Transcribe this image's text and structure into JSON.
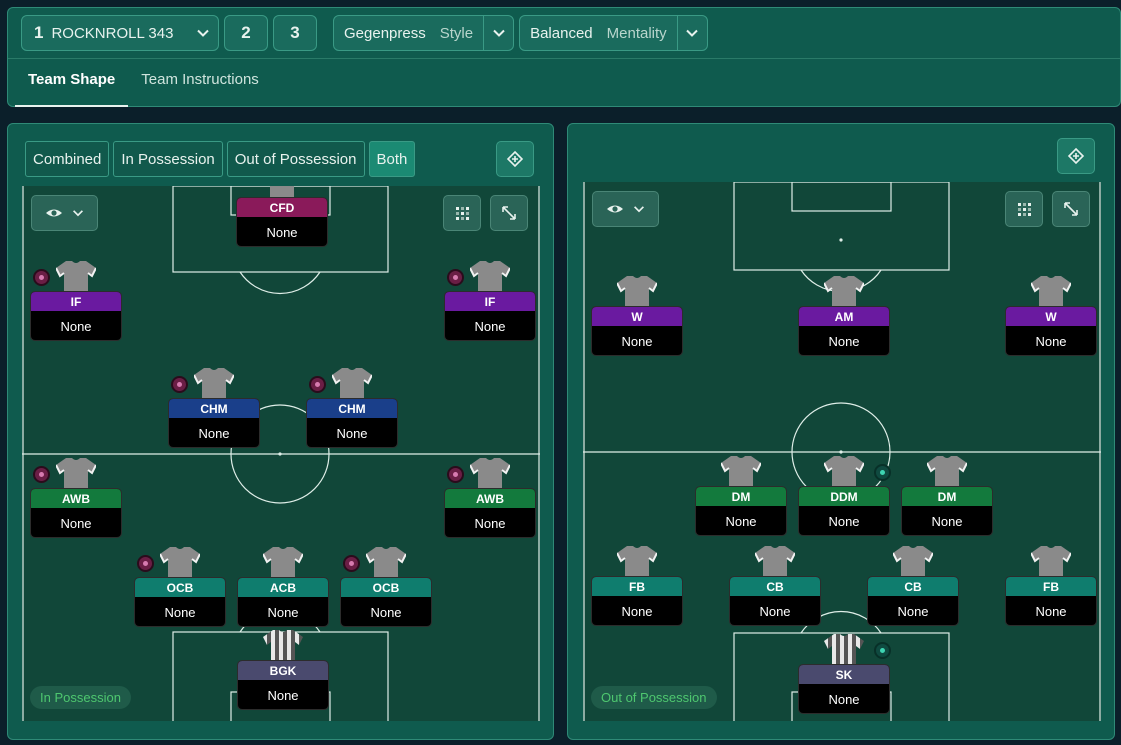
{
  "topbar": {
    "slot1": {
      "number": "1",
      "name": "ROCKNROLL 343"
    },
    "slot2": "2",
    "slot3": "3",
    "style": {
      "value": "Gegenpress",
      "label": "Style"
    },
    "mentality": {
      "value": "Balanced",
      "label": "Mentality"
    },
    "tabs": [
      "Team Shape",
      "Team Instructions"
    ]
  },
  "left_panel": {
    "toggles": [
      "Combined",
      "In Possession",
      "Out of Possession",
      "Both"
    ],
    "active_toggle": "Both",
    "badge": "In Possession",
    "players": [
      {
        "role": "CFD",
        "name": "None",
        "color": "#8a1a5a",
        "kit": "grey",
        "token": ""
      },
      {
        "role": "IF",
        "name": "None",
        "color": "#6a1aa0",
        "kit": "grey",
        "token": "pink"
      },
      {
        "role": "IF",
        "name": "None",
        "color": "#6a1aa0",
        "kit": "grey",
        "token": "pink"
      },
      {
        "role": "CHM",
        "name": "None",
        "color": "#1a3f8a",
        "kit": "grey",
        "token": "pink"
      },
      {
        "role": "CHM",
        "name": "None",
        "color": "#1a3f8a",
        "kit": "grey",
        "token": "pink"
      },
      {
        "role": "AWB",
        "name": "None",
        "color": "#137a3d",
        "kit": "grey",
        "token": "pink"
      },
      {
        "role": "AWB",
        "name": "None",
        "color": "#137a3d",
        "kit": "grey",
        "token": "pink"
      },
      {
        "role": "OCB",
        "name": "None",
        "color": "#0f7d6e",
        "kit": "grey",
        "token": "pink"
      },
      {
        "role": "ACB",
        "name": "None",
        "color": "#0f7d6e",
        "kit": "grey",
        "token": ""
      },
      {
        "role": "OCB",
        "name": "None",
        "color": "#0f7d6e",
        "kit": "grey",
        "token": "pink"
      },
      {
        "role": "BGK",
        "name": "None",
        "color": "#4a4a6e",
        "kit": "stripe",
        "token": ""
      }
    ]
  },
  "right_panel": {
    "badge": "Out of Possession",
    "players": [
      {
        "role": "W",
        "name": "None",
        "color": "#6a1aa0",
        "kit": "grey",
        "token": ""
      },
      {
        "role": "AM",
        "name": "None",
        "color": "#6a1aa0",
        "kit": "grey",
        "token": ""
      },
      {
        "role": "W",
        "name": "None",
        "color": "#6a1aa0",
        "kit": "grey",
        "token": ""
      },
      {
        "role": "DM",
        "name": "None",
        "color": "#137a3d",
        "kit": "grey",
        "token": ""
      },
      {
        "role": "DDM",
        "name": "None",
        "color": "#137a3d",
        "kit": "grey",
        "token": "teal"
      },
      {
        "role": "DM",
        "name": "None",
        "color": "#137a3d",
        "kit": "grey",
        "token": ""
      },
      {
        "role": "FB",
        "name": "None",
        "color": "#0f7d6e",
        "kit": "grey",
        "token": ""
      },
      {
        "role": "CB",
        "name": "None",
        "color": "#0f7d6e",
        "kit": "grey",
        "token": ""
      },
      {
        "role": "CB",
        "name": "None",
        "color": "#0f7d6e",
        "kit": "grey",
        "token": ""
      },
      {
        "role": "FB",
        "name": "None",
        "color": "#0f7d6e",
        "kit": "grey",
        "token": ""
      },
      {
        "role": "SK",
        "name": "None",
        "color": "#4a4a6e",
        "kit": "stripe",
        "token": "teal"
      }
    ]
  }
}
